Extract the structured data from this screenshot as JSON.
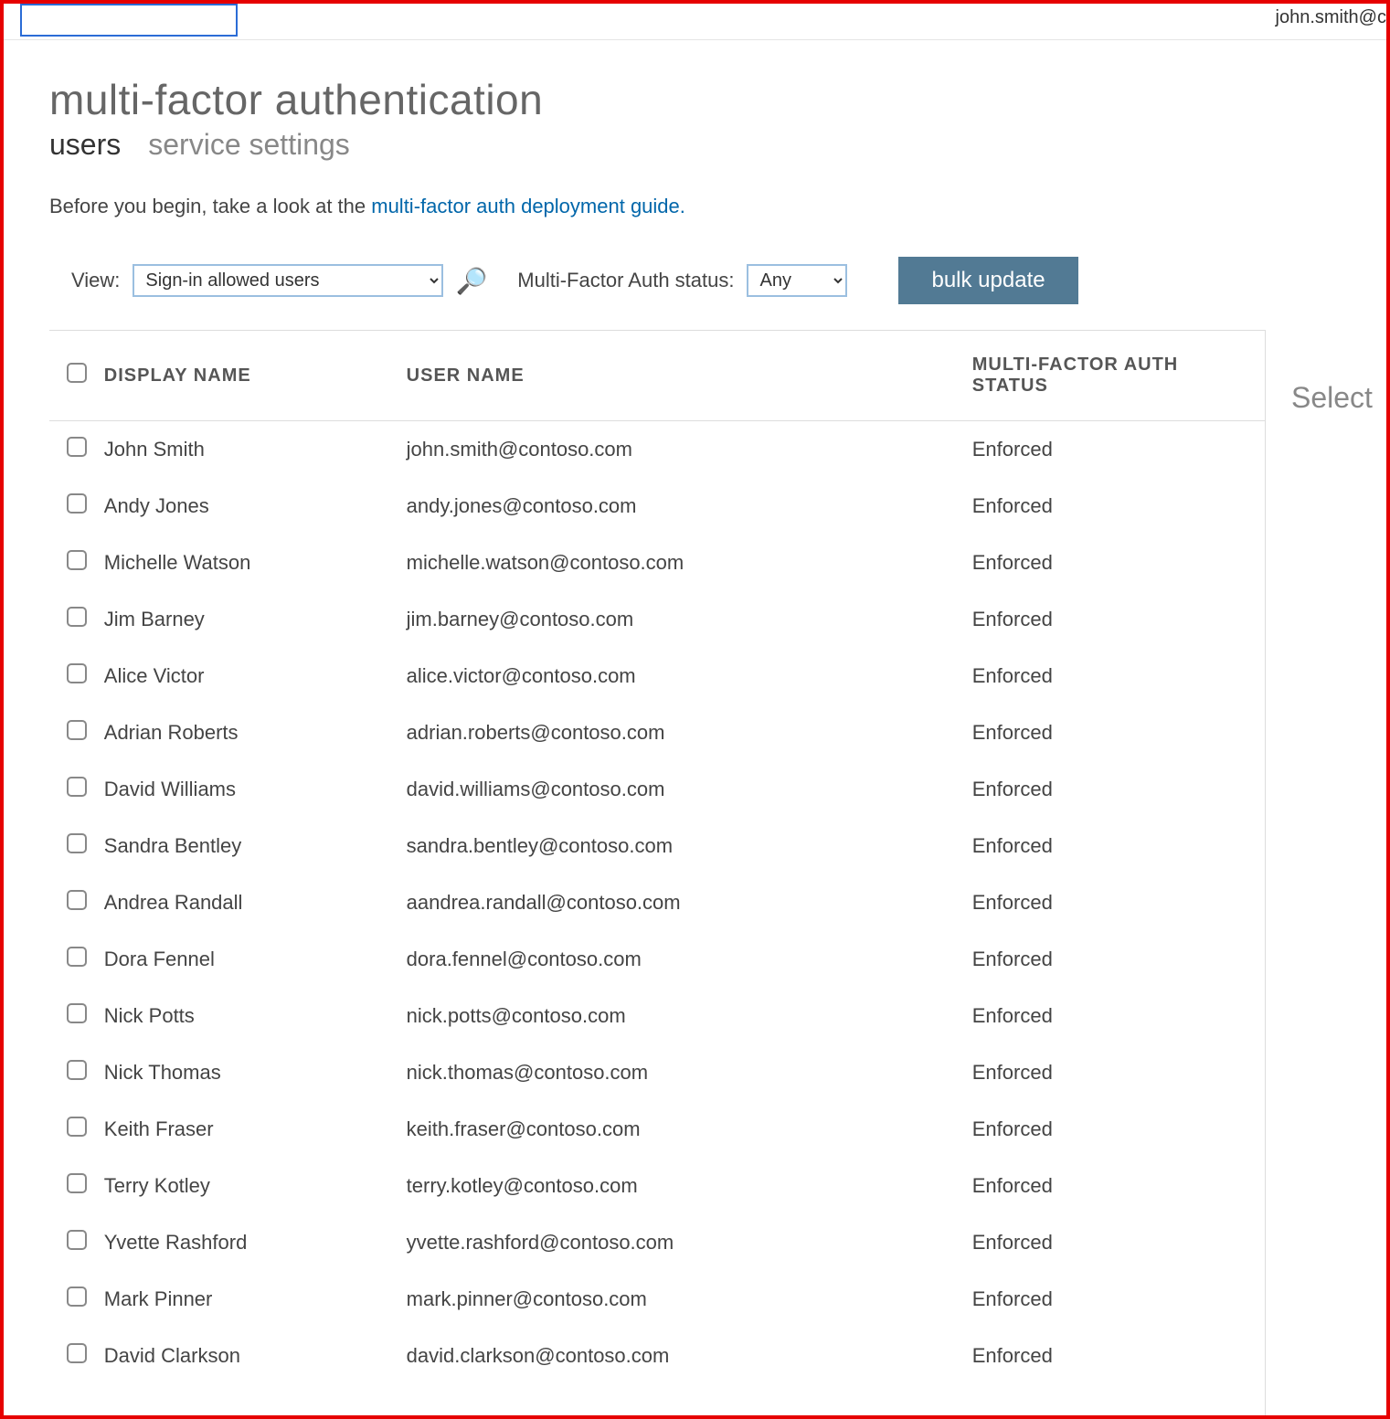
{
  "header": {
    "signed_in_user": "john.smith@c"
  },
  "title": "multi-factor authentication",
  "tabs": {
    "users": "users",
    "service_settings": "service settings"
  },
  "intro": {
    "prefix": "Before you begin, take a look at the ",
    "link_text": "multi-factor auth deployment guide.",
    "suffix": ""
  },
  "filters": {
    "view_label": "View:",
    "view_value": "Sign-in allowed users",
    "status_label": "Multi-Factor Auth status:",
    "status_value": "Any",
    "bulk_update": "bulk update"
  },
  "columns": {
    "display_name": "DISPLAY NAME",
    "user_name": "USER NAME",
    "status": "MULTI-FACTOR AUTH STATUS"
  },
  "side_panel": {
    "hint": "Select"
  },
  "users": [
    {
      "display_name": "John Smith",
      "user_name": "john.smith@contoso.com",
      "status": "Enforced"
    },
    {
      "display_name": "Andy Jones",
      "user_name": "andy.jones@contoso.com",
      "status": "Enforced"
    },
    {
      "display_name": "Michelle Watson",
      "user_name": "michelle.watson@contoso.com",
      "status": "Enforced"
    },
    {
      "display_name": "Jim Barney",
      "user_name": "jim.barney@contoso.com",
      "status": "Enforced"
    },
    {
      "display_name": "Alice Victor",
      "user_name": "alice.victor@contoso.com",
      "status": "Enforced"
    },
    {
      "display_name": "Adrian Roberts",
      "user_name": "adrian.roberts@contoso.com",
      "status": "Enforced"
    },
    {
      "display_name": "David Williams",
      "user_name": "david.williams@contoso.com",
      "status": "Enforced"
    },
    {
      "display_name": "Sandra Bentley",
      "user_name": "sandra.bentley@contoso.com",
      "status": "Enforced"
    },
    {
      "display_name": "Andrea Randall",
      "user_name": "aandrea.randall@contoso.com",
      "status": "Enforced"
    },
    {
      "display_name": "Dora Fennel",
      "user_name": "dora.fennel@contoso.com",
      "status": "Enforced"
    },
    {
      "display_name": "Nick Potts",
      "user_name": "nick.potts@contoso.com",
      "status": "Enforced"
    },
    {
      "display_name": "Nick Thomas",
      "user_name": "nick.thomas@contoso.com",
      "status": "Enforced"
    },
    {
      "display_name": "Keith Fraser",
      "user_name": "keith.fraser@contoso.com",
      "status": "Enforced"
    },
    {
      "display_name": "Terry Kotley",
      "user_name": "terry.kotley@contoso.com",
      "status": "Enforced"
    },
    {
      "display_name": "Yvette Rashford",
      "user_name": "yvette.rashford@contoso.com",
      "status": "Enforced"
    },
    {
      "display_name": "Mark Pinner",
      "user_name": "mark.pinner@contoso.com",
      "status": "Enforced"
    },
    {
      "display_name": "David Clarkson",
      "user_name": "david.clarkson@contoso.com",
      "status": "Enforced"
    }
  ]
}
